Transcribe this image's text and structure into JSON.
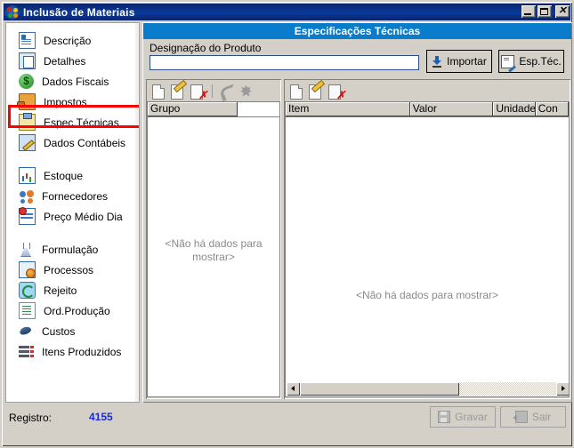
{
  "window": {
    "title": "Inclusão de Materiais",
    "icon": "app-globe-icon",
    "controls": {
      "minimize": "minimize-button",
      "maximize": "maximize-button",
      "close": "✕"
    }
  },
  "sidebar": {
    "items": [
      {
        "label": "Descrição",
        "icon": "document-icon",
        "icon_class": "ic-doc",
        "selected": false
      },
      {
        "label": "Detalhes",
        "icon": "copy-pages-icon",
        "icon_class": "ic-copy",
        "selected": false
      },
      {
        "label": "Dados Fiscais",
        "icon": "dollar-icon",
        "icon_class": "ic-dollar",
        "selected": false
      },
      {
        "label": "Impostos",
        "icon": "hand-money-icon",
        "icon_class": "ic-tax",
        "selected": false
      },
      {
        "label": "Espec.Técnicas",
        "icon": "clipboard-icon",
        "icon_class": "ic-clip",
        "selected": true
      },
      {
        "label": "Dados Contábeis",
        "icon": "pencil-paper-icon",
        "icon_class": "ic-pencil",
        "selected": false
      },
      {
        "label": "Estoque",
        "icon": "bar-chart-icon",
        "icon_class": "ic-chart",
        "selected": false
      },
      {
        "label": "Fornecedores",
        "icon": "users-icon",
        "icon_class": "ic-users",
        "selected": false
      },
      {
        "label": "Preço Médio Dia",
        "icon": "price-table-icon",
        "icon_class": "ic-price",
        "selected": false
      },
      {
        "label": "Formulação",
        "icon": "flask-icon",
        "icon_class": "ic-flask",
        "selected": false
      },
      {
        "label": "Processos",
        "icon": "gear-document-icon",
        "icon_class": "ic-proc",
        "selected": false
      },
      {
        "label": "Rejeito",
        "icon": "recycle-icon",
        "icon_class": "ic-rej",
        "selected": false
      },
      {
        "label": "Ord.Produção",
        "icon": "list-document-icon",
        "icon_class": "ic-ord",
        "selected": false
      },
      {
        "label": "Custos",
        "icon": "mouse-icon",
        "icon_class": "ic-cost",
        "selected": false
      },
      {
        "label": "Itens Produzidos",
        "icon": "stacked-rows-icon",
        "icon_class": "ic-items",
        "selected": false
      }
    ],
    "highlight_color": "#ff0000"
  },
  "panel": {
    "header_title": "Especificações Técnicas",
    "header_color": "#0a7ccc",
    "product_label": "Designação do Produto",
    "product_value": "",
    "product_placeholder": "",
    "buttons": {
      "import_label": "Importar",
      "esptec_label": "Esp.Téc."
    }
  },
  "left_grid": {
    "toolbar": [
      {
        "name": "new-record-button",
        "enabled": true
      },
      {
        "name": "edit-record-button",
        "enabled": true
      },
      {
        "name": "delete-record-button",
        "enabled": true
      },
      {
        "name": "undo-button",
        "enabled": false
      },
      {
        "name": "clear-all-button",
        "enabled": false
      }
    ],
    "columns": [
      "Grupo"
    ],
    "rows": [],
    "empty_text": "<Não há dados para mostrar>"
  },
  "right_grid": {
    "toolbar": [
      {
        "name": "new-item-button",
        "enabled": true
      },
      {
        "name": "edit-item-button",
        "enabled": true
      },
      {
        "name": "delete-item-button",
        "enabled": true
      }
    ],
    "columns": [
      "Item",
      "Valor",
      "Unidade",
      "Con"
    ],
    "rows": [],
    "empty_text": "<Não há dados para mostrar>",
    "hscroll": {
      "thumb_percent": 62
    }
  },
  "status": {
    "registro_label": "Registro:",
    "registro_value": "4155",
    "registro_color": "#1a2ecc",
    "save_label": "Gravar",
    "exit_label": "Sair",
    "save_enabled": false,
    "exit_enabled": false
  }
}
